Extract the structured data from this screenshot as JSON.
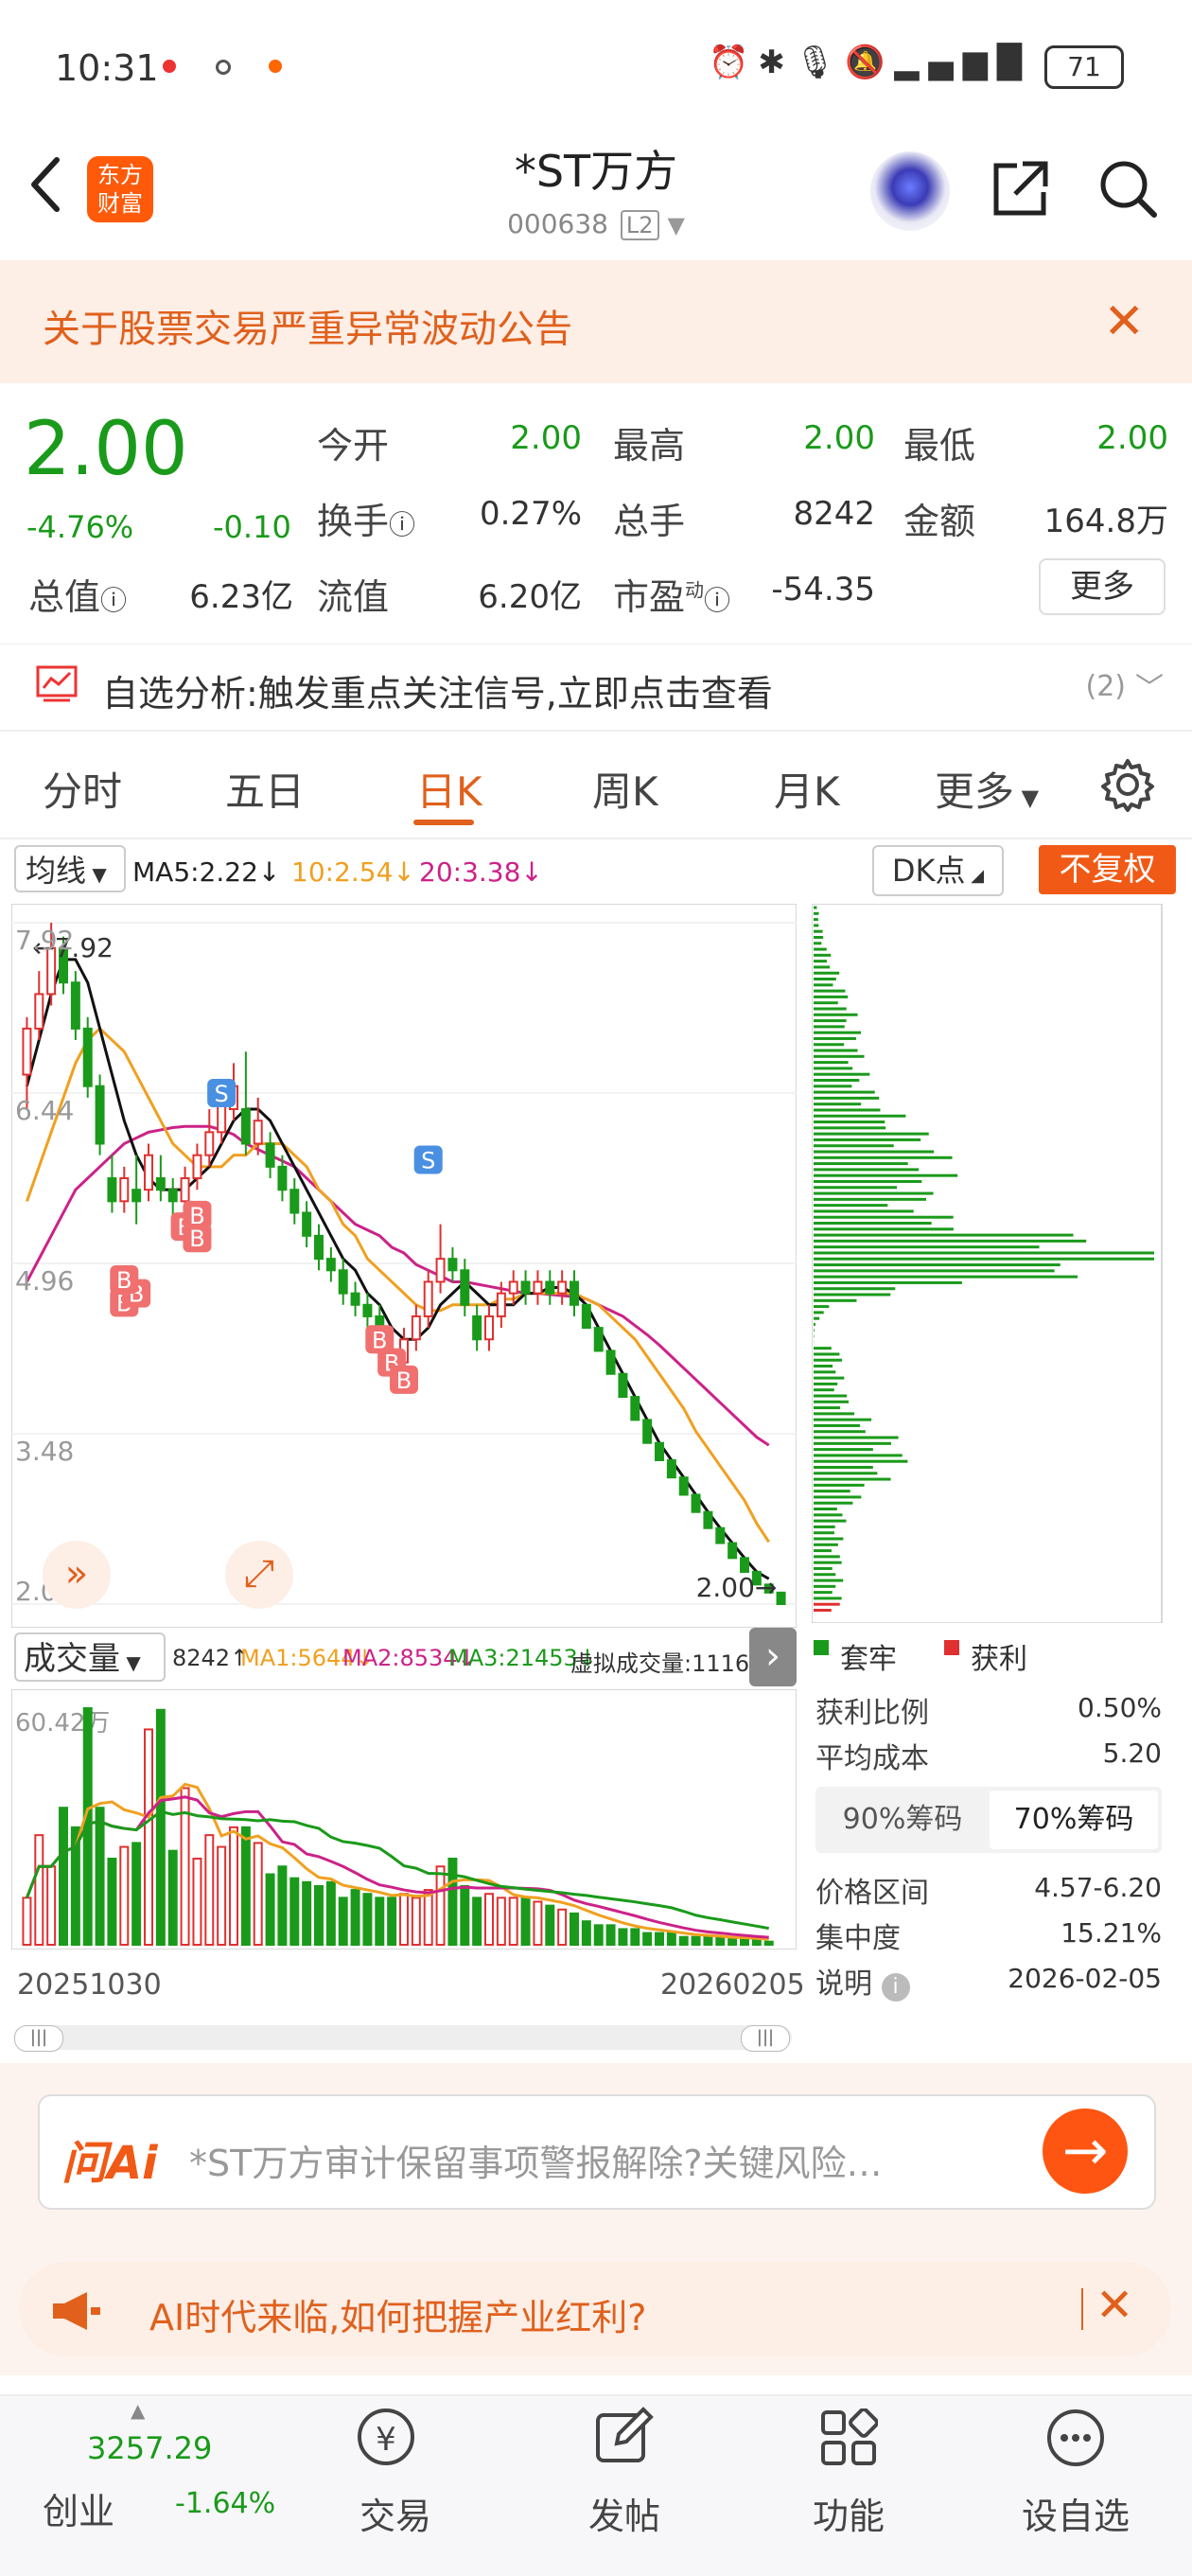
{
  "status": {
    "time": "10:31",
    "battery": "71"
  },
  "header": {
    "stock_name": "*ST万方",
    "stock_code": "000638",
    "level": "L2",
    "brand": [
      "东方",
      "财富"
    ]
  },
  "notice": {
    "text": "关于股票交易严重异常波动公告"
  },
  "quote": {
    "price": "2.00",
    "pct": "-4.76%",
    "change": "-0.10",
    "open_lbl": "今开",
    "open": "2.00",
    "high_lbl": "最高",
    "high": "2.00",
    "low_lbl": "最低",
    "low": "2.00",
    "turnover_lbl": "换手",
    "turnover": "0.27%",
    "vol_lbl": "总手",
    "vol": "8242",
    "amount_lbl": "金额",
    "amount": "164.8万",
    "mktcap_lbl": "总值",
    "mktcap": "6.23亿",
    "float_lbl": "流值",
    "float": "6.20亿",
    "pe_lbl": "市盈",
    "pe_sup": "动",
    "pe": "-54.35",
    "more": "更多"
  },
  "analysis": {
    "text": "自选分析:触发重点关注信号,立即点击查看",
    "count": "(2)"
  },
  "tabs": [
    "分时",
    "五日",
    "日K",
    "周K",
    "月K",
    "更多"
  ],
  "kline_bar": {
    "select": "均线",
    "ma5": "MA5:2.22↓",
    "ma10": "10:2.54↓",
    "ma20": "20:3.38↓",
    "dk": "DK点",
    "fq": "不复权"
  },
  "vol_bar": {
    "select": "成交量",
    "v": "8242↑",
    "ma1": "MA1:5644↓",
    "ma2": "MA2:8534↓",
    "ma3": "MA3:21453↓",
    "virtual": "虚拟成交量:11163"
  },
  "colors": {
    "up": "#e03030",
    "down": "#1a9a1a",
    "ma5": "#111111",
    "ma10": "#f0a020",
    "ma20": "#cc2288",
    "accent": "#f05a16"
  },
  "chart_data": {
    "type": "candlestick",
    "y_ticks": [
      "7.92",
      "6.44",
      "4.96",
      "3.48",
      "2.00"
    ],
    "max_label": "7.92",
    "min_label": "2.00",
    "x_labels": [
      "20251030",
      "20260205"
    ],
    "vol_label": "60.42万",
    "candles": [
      {
        "o": 6.6,
        "c": 7.0,
        "h": 7.1,
        "l": 6.3
      },
      {
        "o": 7.0,
        "c": 7.3,
        "h": 7.5,
        "l": 6.9
      },
      {
        "o": 7.3,
        "c": 7.7,
        "h": 7.92,
        "l": 7.2
      },
      {
        "o": 7.7,
        "c": 7.4,
        "h": 7.8,
        "l": 7.3
      },
      {
        "o": 7.4,
        "c": 7.0,
        "h": 7.5,
        "l": 6.9
      },
      {
        "o": 7.0,
        "c": 6.5,
        "h": 7.1,
        "l": 6.4
      },
      {
        "o": 6.5,
        "c": 6.0,
        "h": 6.6,
        "l": 5.9
      },
      {
        "o": 5.7,
        "c": 5.5,
        "h": 5.9,
        "l": 5.4
      },
      {
        "o": 5.5,
        "c": 5.7,
        "h": 5.8,
        "l": 5.4
      },
      {
        "o": 5.6,
        "c": 5.5,
        "h": 5.9,
        "l": 5.3
      },
      {
        "o": 5.6,
        "c": 5.9,
        "h": 6.0,
        "l": 5.5
      },
      {
        "o": 5.7,
        "c": 5.6,
        "h": 5.9,
        "l": 5.5
      },
      {
        "o": 5.6,
        "c": 5.5,
        "h": 5.7,
        "l": 5.3
      },
      {
        "o": 5.5,
        "c": 5.7,
        "h": 5.8,
        "l": 5.4
      },
      {
        "o": 5.7,
        "c": 5.9,
        "h": 6.0,
        "l": 5.6
      },
      {
        "o": 5.9,
        "c": 6.1,
        "h": 6.3,
        "l": 5.8
      },
      {
        "o": 6.1,
        "c": 6.4,
        "h": 6.5,
        "l": 6.0
      },
      {
        "o": 6.3,
        "c": 6.5,
        "h": 6.7,
        "l": 6.2
      },
      {
        "o": 6.3,
        "c": 6.0,
        "h": 6.8,
        "l": 5.9
      },
      {
        "o": 6.0,
        "c": 6.2,
        "h": 6.4,
        "l": 5.9
      },
      {
        "o": 6.0,
        "c": 5.8,
        "h": 6.1,
        "l": 5.7
      },
      {
        "o": 5.8,
        "c": 5.6,
        "h": 5.9,
        "l": 5.5
      },
      {
        "o": 5.6,
        "c": 5.4,
        "h": 5.7,
        "l": 5.3
      },
      {
        "o": 5.4,
        "c": 5.2,
        "h": 5.5,
        "l": 5.1
      },
      {
        "o": 5.2,
        "c": 5.0,
        "h": 5.3,
        "l": 4.9
      },
      {
        "o": 5.0,
        "c": 4.9,
        "h": 5.1,
        "l": 4.8
      },
      {
        "o": 4.9,
        "c": 4.7,
        "h": 5.0,
        "l": 4.6
      },
      {
        "o": 4.7,
        "c": 4.6,
        "h": 4.8,
        "l": 4.5
      },
      {
        "o": 4.6,
        "c": 4.5,
        "h": 4.7,
        "l": 4.4
      },
      {
        "o": 4.5,
        "c": 4.3,
        "h": 4.6,
        "l": 4.2
      },
      {
        "o": 4.2,
        "c": 4.1,
        "h": 4.3,
        "l": 4.0
      },
      {
        "o": 4.1,
        "c": 4.3,
        "h": 4.4,
        "l": 4.0
      },
      {
        "o": 4.3,
        "c": 4.5,
        "h": 4.6,
        "l": 4.2
      },
      {
        "o": 4.5,
        "c": 4.8,
        "h": 4.9,
        "l": 4.4
      },
      {
        "o": 4.8,
        "c": 5.0,
        "h": 5.3,
        "l": 4.7
      },
      {
        "o": 5.0,
        "c": 4.9,
        "h": 5.1,
        "l": 4.8
      },
      {
        "o": 4.9,
        "c": 4.6,
        "h": 5.0,
        "l": 4.5
      },
      {
        "o": 4.5,
        "c": 4.3,
        "h": 4.6,
        "l": 4.2
      },
      {
        "o": 4.3,
        "c": 4.5,
        "h": 4.6,
        "l": 4.2
      },
      {
        "o": 4.5,
        "c": 4.7,
        "h": 4.8,
        "l": 4.4
      },
      {
        "o": 4.7,
        "c": 4.8,
        "h": 4.9,
        "l": 4.6
      },
      {
        "o": 4.8,
        "c": 4.7,
        "h": 4.9,
        "l": 4.6
      },
      {
        "o": 4.7,
        "c": 4.8,
        "h": 4.9,
        "l": 4.6
      },
      {
        "o": 4.8,
        "c": 4.7,
        "h": 4.9,
        "l": 4.6
      },
      {
        "o": 4.7,
        "c": 4.8,
        "h": 4.9,
        "l": 4.6
      },
      {
        "o": 4.8,
        "c": 4.6,
        "h": 4.9,
        "l": 4.5
      },
      {
        "o": 4.6,
        "c": 4.4,
        "h": 4.6,
        "l": 4.4
      },
      {
        "o": 4.4,
        "c": 4.2,
        "h": 4.4,
        "l": 4.2
      },
      {
        "o": 4.2,
        "c": 4.0,
        "h": 4.2,
        "l": 4.0
      },
      {
        "o": 4.0,
        "c": 3.8,
        "h": 4.0,
        "l": 3.8
      },
      {
        "o": 3.8,
        "c": 3.6,
        "h": 3.8,
        "l": 3.6
      },
      {
        "o": 3.6,
        "c": 3.4,
        "h": 3.6,
        "l": 3.4
      },
      {
        "o": 3.4,
        "c": 3.25,
        "h": 3.4,
        "l": 3.25
      },
      {
        "o": 3.25,
        "c": 3.1,
        "h": 3.25,
        "l": 3.1
      },
      {
        "o": 3.1,
        "c": 2.95,
        "h": 3.1,
        "l": 2.95
      },
      {
        "o": 2.95,
        "c": 2.8,
        "h": 2.95,
        "l": 2.8
      },
      {
        "o": 2.8,
        "c": 2.66,
        "h": 2.8,
        "l": 2.66
      },
      {
        "o": 2.66,
        "c": 2.53,
        "h": 2.66,
        "l": 2.53
      },
      {
        "o": 2.53,
        "c": 2.4,
        "h": 2.53,
        "l": 2.4
      },
      {
        "o": 2.4,
        "c": 2.28,
        "h": 2.4,
        "l": 2.28
      },
      {
        "o": 2.28,
        "c": 2.17,
        "h": 2.28,
        "l": 2.17
      },
      {
        "o": 2.17,
        "c": 2.1,
        "h": 2.17,
        "l": 2.1
      },
      {
        "o": 2.1,
        "c": 2.0,
        "h": 2.1,
        "l": 2.0
      }
    ],
    "ma5": [
      6.5,
      6.9,
      7.3,
      7.6,
      7.6,
      7.4,
      7.0,
      6.6,
      6.2,
      5.9,
      5.7,
      5.6,
      5.6,
      5.6,
      5.7,
      5.8,
      6.0,
      6.2,
      6.3,
      6.3,
      6.2,
      6.0,
      5.8,
      5.6,
      5.4,
      5.2,
      5.0,
      4.9,
      4.7,
      4.6,
      4.4,
      4.3,
      4.3,
      4.4,
      4.6,
      4.7,
      4.8,
      4.7,
      4.6,
      4.6,
      4.6,
      4.7,
      4.7,
      4.75,
      4.75,
      4.7,
      4.6,
      4.4,
      4.2,
      4.0,
      3.8,
      3.6,
      3.4,
      3.25,
      3.1,
      2.95,
      2.8,
      2.66,
      2.53,
      2.4,
      2.28,
      2.22
    ],
    "ma10": [
      5.5,
      5.8,
      6.1,
      6.4,
      6.7,
      6.9,
      7.0,
      6.9,
      6.8,
      6.6,
      6.4,
      6.2,
      6.0,
      5.9,
      5.8,
      5.8,
      5.8,
      5.9,
      5.9,
      6.0,
      6.0,
      6.0,
      5.9,
      5.8,
      5.6,
      5.5,
      5.3,
      5.2,
      5.0,
      4.9,
      4.8,
      4.7,
      4.6,
      4.55,
      4.55,
      4.6,
      4.6,
      4.6,
      4.6,
      4.65,
      4.65,
      4.7,
      4.7,
      4.7,
      4.7,
      4.7,
      4.65,
      4.6,
      4.5,
      4.4,
      4.3,
      4.15,
      4.0,
      3.85,
      3.7,
      3.5,
      3.35,
      3.2,
      3.05,
      2.9,
      2.7,
      2.54
    ],
    "ma20": [
      4.8,
      5.0,
      5.2,
      5.4,
      5.6,
      5.7,
      5.8,
      5.9,
      6.0,
      6.05,
      6.1,
      6.12,
      6.14,
      6.15,
      6.15,
      6.15,
      6.12,
      6.08,
      6.0,
      5.95,
      5.9,
      5.85,
      5.8,
      5.7,
      5.6,
      5.5,
      5.4,
      5.3,
      5.25,
      5.2,
      5.1,
      5.05,
      4.95,
      4.9,
      4.85,
      4.8,
      4.8,
      4.78,
      4.76,
      4.74,
      4.72,
      4.7,
      4.7,
      4.69,
      4.68,
      4.67,
      4.65,
      4.6,
      4.55,
      4.5,
      4.42,
      4.34,
      4.25,
      4.15,
      4.05,
      3.95,
      3.85,
      3.75,
      3.65,
      3.55,
      3.45,
      3.38
    ],
    "volumes": [
      12,
      28,
      20,
      35,
      30,
      60.42,
      35,
      22,
      25,
      26,
      55,
      60,
      24,
      40,
      22,
      28,
      25,
      30,
      30,
      26,
      18,
      20,
      17,
      16,
      15,
      16,
      12,
      14,
      13,
      12,
      12,
      13,
      12,
      14,
      20,
      22,
      15,
      12,
      13,
      12,
      12,
      12,
      11,
      10,
      9,
      8,
      6,
      5,
      5,
      4,
      4,
      3,
      3,
      3,
      2,
      2,
      2,
      2,
      1.5,
      1.5,
      1.2,
      0.8
    ],
    "chips": {
      "legend": [
        "套牢",
        "获利"
      ],
      "profit_ratio_lbl": "获利比例",
      "profit_ratio": "0.50%",
      "avg_cost_lbl": "平均成本",
      "avg_cost": "5.20",
      "tab90": "90%筹码",
      "tab70": "70%筹码",
      "range_lbl": "价格区间",
      "range": "4.57-6.20",
      "conc_lbl": "集中度",
      "conc": "15.21%",
      "note_lbl": "说明",
      "date": "2026-02-05"
    }
  },
  "ai": {
    "logo": "问Ai",
    "prompt": "*ST万方审计保留事项警报解除?关键风险…"
  },
  "promo": {
    "text": "AI时代来临,如何把握产业红利?"
  },
  "nav": {
    "index_value": "3257.29",
    "index_name": "创业",
    "index_pct": "-1.64%",
    "trade": "交易",
    "post": "发帖",
    "func": "功能",
    "watch": "设自选"
  }
}
